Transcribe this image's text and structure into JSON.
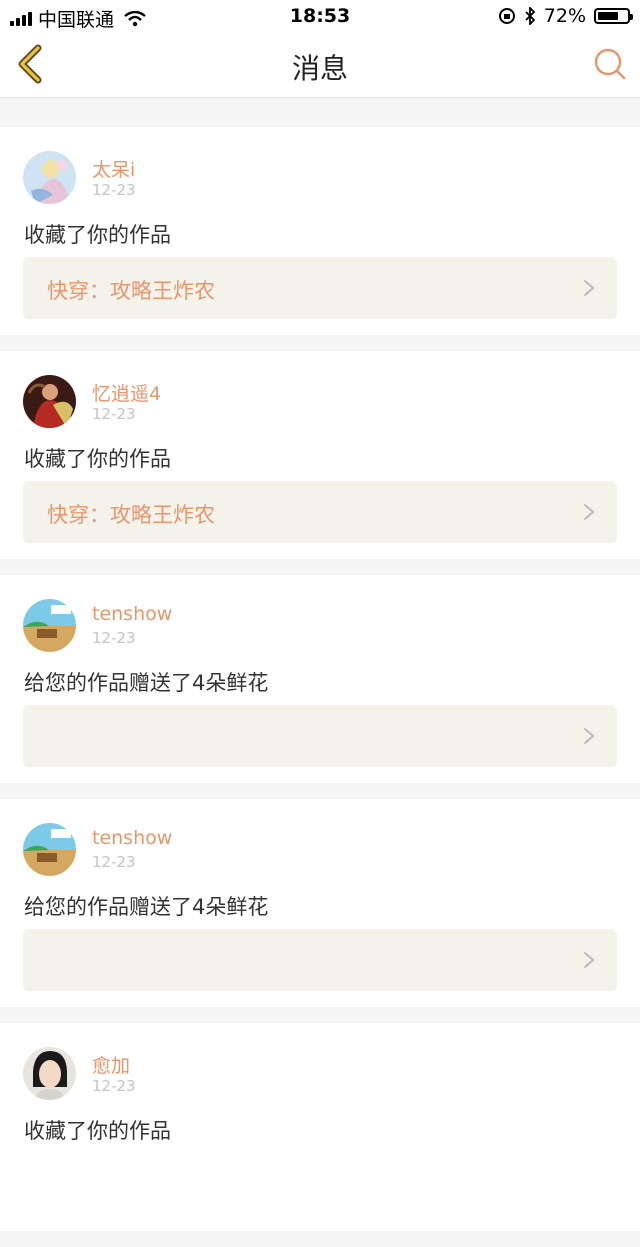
{
  "status_bar": {
    "carrier": "中国联通",
    "time": "18:53",
    "battery_percent": "72%",
    "battery_level": 0.72,
    "icons": [
      "signal-icon",
      "wifi-icon",
      "orientation-lock-icon",
      "bluetooth-icon",
      "battery-icon"
    ]
  },
  "nav": {
    "title": "消息",
    "back_icon": "chevron-left-icon",
    "search_icon": "search-icon",
    "accent_color": "#e8956b"
  },
  "messages": [
    {
      "username": "太呆i",
      "date": "12-23",
      "text": "收藏了你的作品",
      "work_title": "快穿：攻略王炸农"
    },
    {
      "username": "忆逍遥4",
      "date": "12-23",
      "text": "收藏了你的作品",
      "work_title": "快穿：攻略王炸农"
    },
    {
      "username": "tenshow",
      "date": "12-23",
      "text": "给您的作品赠送了4朵鲜花",
      "work_title": ""
    },
    {
      "username": "tenshow",
      "date": "12-23",
      "text": "给您的作品赠送了4朵鲜花",
      "work_title": ""
    },
    {
      "username": "愈加",
      "date": "12-23",
      "text": "收藏了你的作品",
      "work_title": ""
    }
  ]
}
